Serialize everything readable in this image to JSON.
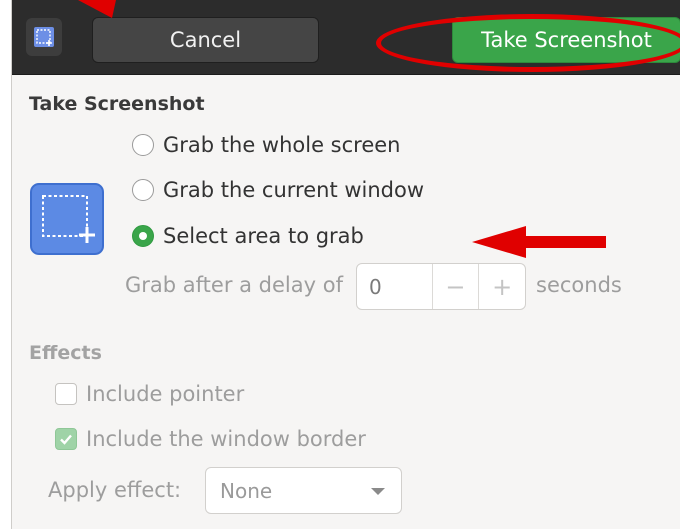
{
  "header": {
    "cancel_label": "Cancel",
    "take_label": "Take Screenshot"
  },
  "main": {
    "title": "Take Screenshot",
    "options": [
      {
        "label": "Grab the whole screen",
        "selected": false
      },
      {
        "label": "Grab the current window",
        "selected": false
      },
      {
        "label": "Select area to grab",
        "selected": true
      }
    ],
    "delay_label": "Grab after a delay of",
    "delay_value": "0",
    "delay_unit": "seconds",
    "minus": "−",
    "plus": "+"
  },
  "effects": {
    "title": "Effects",
    "include_pointer": {
      "label": "Include pointer",
      "checked": false
    },
    "include_border": {
      "label": "Include the window border",
      "checked": true
    },
    "apply_label": "Apply effect:",
    "apply_value": "None"
  },
  "colors": {
    "accent": "#3aa54a",
    "annotation": "#e00000",
    "header": "#2c2c2c"
  },
  "icons": {
    "app": "screenshot-area-icon",
    "big": "select-area-icon"
  }
}
